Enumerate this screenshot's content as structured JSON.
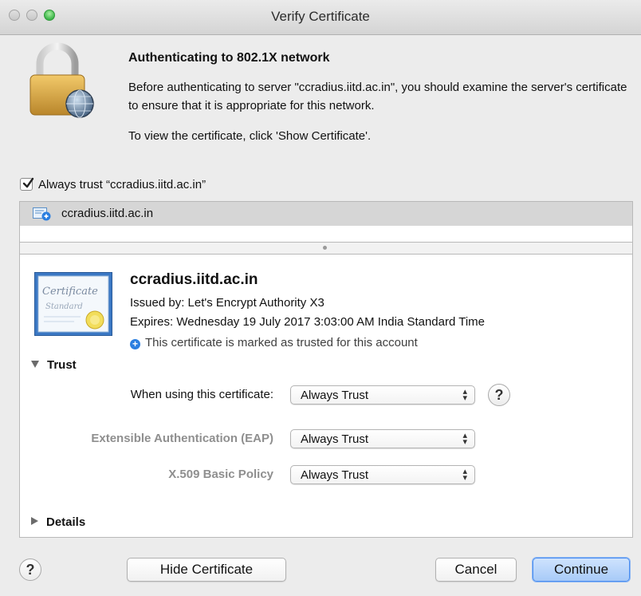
{
  "window": {
    "title": "Verify Certificate"
  },
  "auth": {
    "title": "Authenticating to 802.1X network",
    "description": "Before authenticating to server \"ccradius.iitd.ac.in\", you should examine the server's certificate to ensure that it is appropriate for this network.",
    "view_hint": "To view the certificate, click 'Show Certificate'."
  },
  "always_trust": {
    "label": "Always trust “ccradius.iitd.ac.in”",
    "checked": true
  },
  "cert_list": {
    "items": [
      {
        "label": "ccradius.iitd.ac.in"
      }
    ]
  },
  "certificate": {
    "name": "ccradius.iitd.ac.in",
    "issued_by": "Issued by: Let's Encrypt Authority X3",
    "expires": "Expires: Wednesday 19 July 2017 3:03:00 AM India Standard Time",
    "trusted_note": "This certificate is marked as trusted for this account",
    "badge_text_1": "Certificate",
    "badge_text_2": "Standard"
  },
  "trust": {
    "section_label": "Trust",
    "when_using_label": "When using this certificate:",
    "when_using_value": "Always Trust",
    "eap_label": "Extensible Authentication (EAP)",
    "eap_value": "Always Trust",
    "x509_label": "X.509 Basic Policy",
    "x509_value": "Always Trust"
  },
  "details": {
    "section_label": "Details"
  },
  "buttons": {
    "hide_certificate": "Hide Certificate",
    "cancel": "Cancel",
    "continue": "Continue",
    "help": "?"
  },
  "colors": {
    "accent": "#2b7fe0",
    "default_button": "#a7caf8"
  }
}
